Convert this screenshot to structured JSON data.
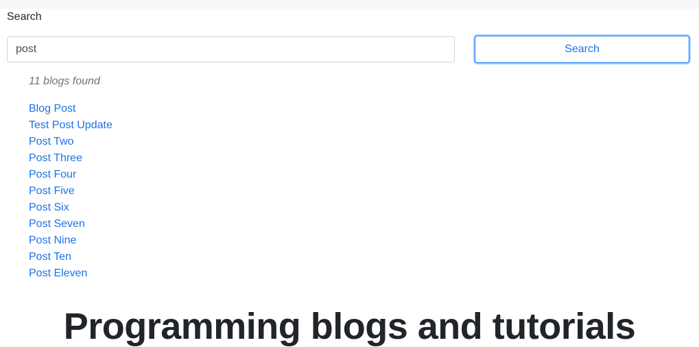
{
  "search": {
    "label": "Search",
    "value": "post",
    "button_label": "Search"
  },
  "results": {
    "count_text": "11 blogs found",
    "items": [
      "Blog Post",
      "Test Post Update",
      "Post Two",
      "Post Three",
      "Post Four",
      "Post Five",
      "Post Six",
      "Post Seven",
      "Post Nine",
      "Post Ten",
      "Post Eleven"
    ]
  },
  "page": {
    "heading": "Programming blogs and tutorials"
  },
  "colors": {
    "link": "#1a73e8",
    "button_border": "#007bff",
    "muted_text": "#6c757d"
  }
}
